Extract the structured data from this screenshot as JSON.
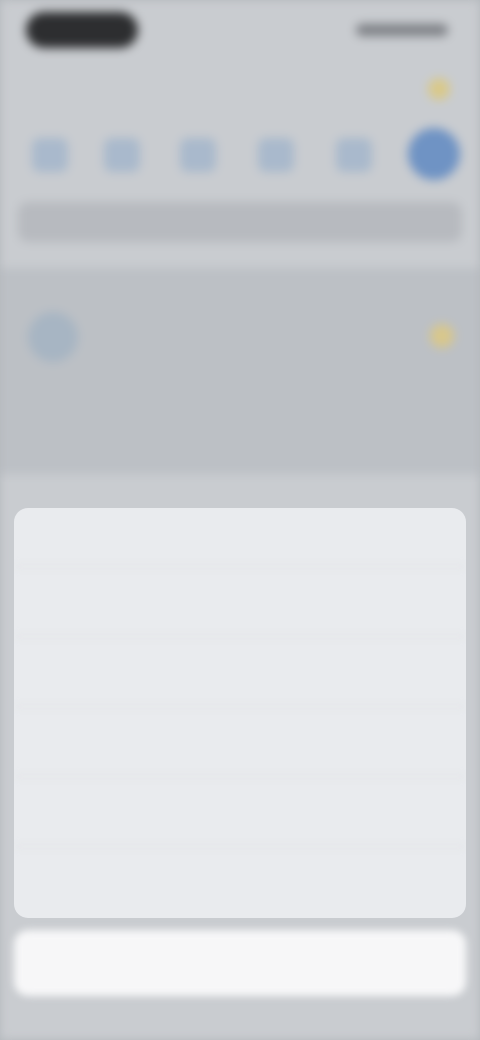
{
  "app": {
    "title": "",
    "list_item_label": ""
  },
  "action_sheet": {
    "title": "",
    "options": [
      {
        "label": ""
      },
      {
        "label": ""
      },
      {
        "label": ""
      },
      {
        "label": ""
      },
      {
        "label": ""
      }
    ],
    "cancel_label": ""
  },
  "colors": {
    "accent": "#4d8fe4",
    "dim_background": "#c9ccd0",
    "sheet_background": "#e9ebee",
    "cancel_background": "#f7f7f8"
  },
  "icons": {
    "toolbar": [
      "toolbar-icon",
      "toolbar-icon",
      "toolbar-icon",
      "toolbar-icon",
      "toolbar-icon",
      "profile-icon"
    ],
    "list_item": "avatar-icon",
    "favorite": "star-icon"
  }
}
